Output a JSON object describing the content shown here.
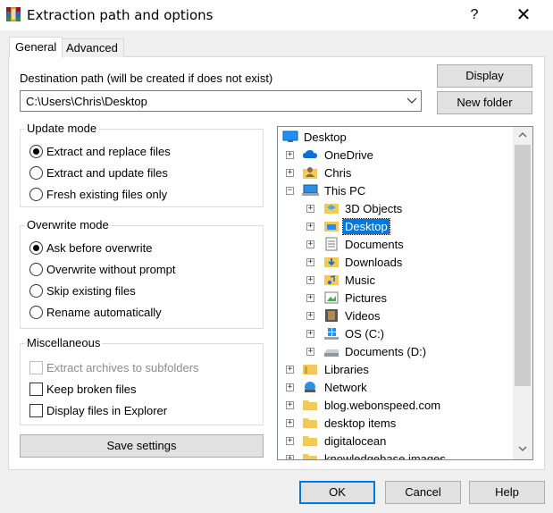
{
  "window": {
    "title": "Extraction path and options",
    "help": "?",
    "close": "✕"
  },
  "tabs": [
    {
      "label": "General"
    },
    {
      "label": "Advanced"
    }
  ],
  "destination": {
    "label": "Destination path (will be created if does not exist)",
    "value": "C:\\Users\\Chris\\Desktop"
  },
  "buttons": {
    "display": "Display",
    "new_folder": "New folder",
    "save_settings": "Save settings",
    "ok": "OK",
    "cancel": "Cancel",
    "help": "Help"
  },
  "update_mode": {
    "title": "Update mode",
    "options": [
      "Extract and replace files",
      "Extract and update files",
      "Fresh existing files only"
    ],
    "selected": 0
  },
  "overwrite_mode": {
    "title": "Overwrite mode",
    "options": [
      "Ask before overwrite",
      "Overwrite without prompt",
      "Skip existing files",
      "Rename automatically"
    ],
    "selected": 0
  },
  "misc": {
    "title": "Miscellaneous",
    "items": [
      {
        "label": "Extract archives to subfolders",
        "checked": false,
        "enabled": false
      },
      {
        "label": "Keep broken files",
        "checked": false,
        "enabled": true
      },
      {
        "label": "Display files in Explorer",
        "checked": false,
        "enabled": true
      }
    ]
  },
  "tree": {
    "items": [
      {
        "label": "Desktop",
        "icon": "desktop-icon"
      },
      {
        "label": "OneDrive",
        "icon": "cloud-icon"
      },
      {
        "label": "Chris",
        "icon": "user-folder-icon"
      },
      {
        "label": "This PC",
        "icon": "computer-icon"
      },
      {
        "label": "3D Objects",
        "icon": "3d-objects-icon"
      },
      {
        "label": "Desktop",
        "icon": "desktop-folder-icon"
      },
      {
        "label": "Documents",
        "icon": "documents-icon"
      },
      {
        "label": "Downloads",
        "icon": "downloads-icon"
      },
      {
        "label": "Music",
        "icon": "music-icon"
      },
      {
        "label": "Pictures",
        "icon": "pictures-icon"
      },
      {
        "label": "Videos",
        "icon": "videos-icon"
      },
      {
        "label": "OS (C:)",
        "icon": "windows-drive-icon"
      },
      {
        "label": "Documents (D:)",
        "icon": "drive-icon"
      },
      {
        "label": "Libraries",
        "icon": "libraries-icon"
      },
      {
        "label": "Network",
        "icon": "network-icon"
      },
      {
        "label": "blog.webonspeed.com",
        "icon": "folder-icon"
      },
      {
        "label": "desktop items",
        "icon": "folder-icon"
      },
      {
        "label": "digitalocean",
        "icon": "folder-icon"
      },
      {
        "label": "knowledgebase images",
        "icon": "folder-icon"
      }
    ],
    "selected_label": "Desktop"
  },
  "colors": {
    "selection": "#0078d7",
    "folder": "#f4c95a"
  }
}
